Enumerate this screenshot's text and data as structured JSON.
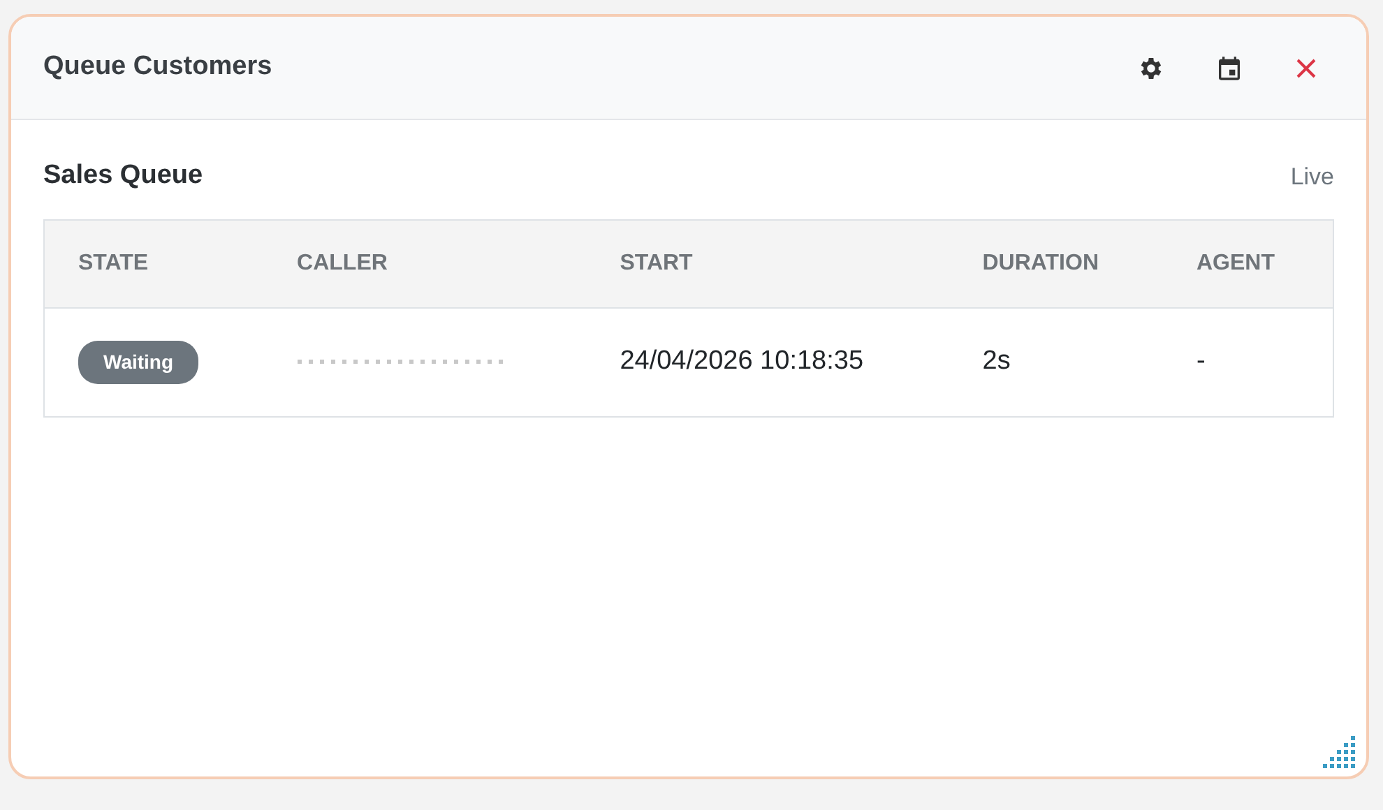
{
  "window": {
    "title": "Queue Customers"
  },
  "section": {
    "title": "Sales Queue",
    "status": "Live"
  },
  "table": {
    "columns": [
      "STATE",
      "CALLER",
      "START",
      "DURATION",
      "AGENT"
    ],
    "rows": [
      {
        "state": "Waiting",
        "caller_redacted": true,
        "start": "24/04/2026 10:18:35",
        "duration": "2s",
        "agent": "-"
      }
    ]
  }
}
